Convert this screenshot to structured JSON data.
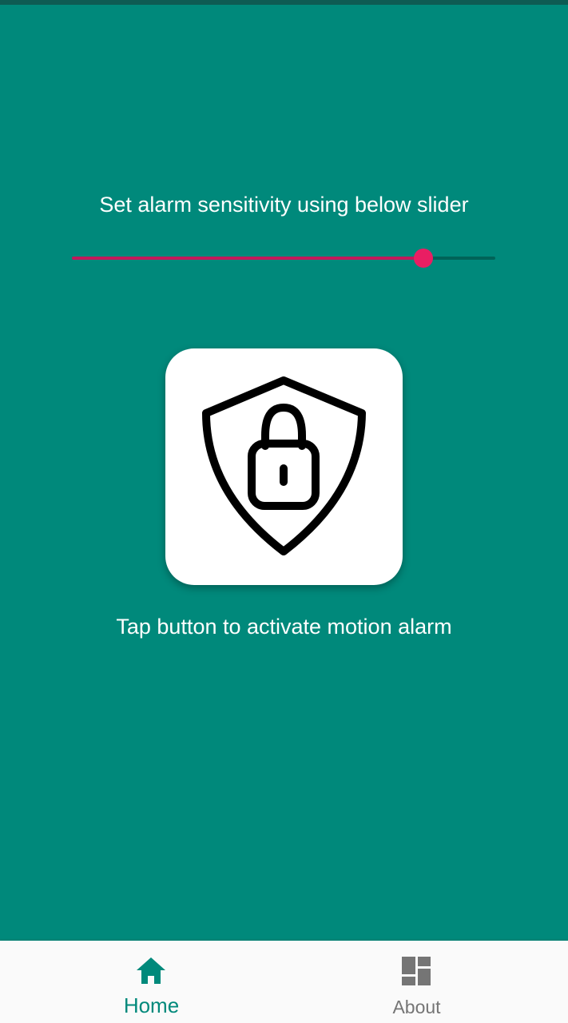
{
  "colors": {
    "background": "#00897B",
    "slider_active": "#C2185B",
    "slider_thumb": "#E91E63",
    "nav_active": "#00897B",
    "nav_inactive": "#757575"
  },
  "home": {
    "instruction": "Set alarm sensitivity using below slider",
    "sensitivity_slider": {
      "value": 0.83
    },
    "alarm_button": {
      "icon": "shield-lock-icon"
    },
    "caption": "Tap button to activate motion alarm"
  },
  "bottom_nav": {
    "items": [
      {
        "label": "Home",
        "icon": "home-icon",
        "active": true
      },
      {
        "label": "About",
        "icon": "dashboard-icon",
        "active": false
      }
    ]
  }
}
